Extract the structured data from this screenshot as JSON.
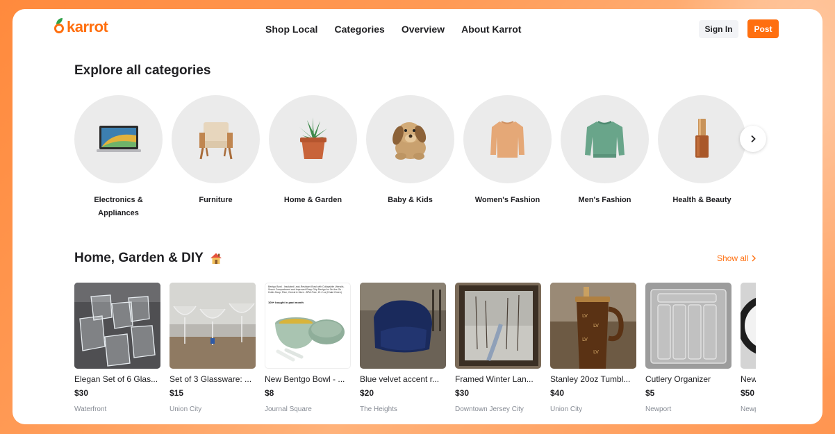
{
  "brand": {
    "name": "karrot",
    "color": "#ff6f0f",
    "leaf_color": "#2fa24a"
  },
  "nav": {
    "items": [
      "Shop Local",
      "Categories",
      "Overview",
      "About Karrot"
    ]
  },
  "header": {
    "signin_label": "Sign In",
    "post_label": "Post"
  },
  "categories": {
    "title": "Explore all categories",
    "items": [
      {
        "label": "Electronics & Appliances",
        "icon": "laptop-icon"
      },
      {
        "label": "Furniture",
        "icon": "armchair-icon"
      },
      {
        "label": "Home & Garden",
        "icon": "plant-icon"
      },
      {
        "label": "Baby & Kids",
        "icon": "plush-dog-icon"
      },
      {
        "label": "Women's Fashion",
        "icon": "sweater-icon"
      },
      {
        "label": "Men's Fashion",
        "icon": "sweatshirt-icon"
      },
      {
        "label": "Health & Beauty",
        "icon": "foundation-bottle-icon"
      }
    ],
    "next_icon": "chevron-right-icon"
  },
  "section": {
    "title": "Home, Garden & DIY",
    "title_icon": "house-icon",
    "show_all_label": "Show all",
    "items": [
      {
        "title": "Elegan Set of 6 Glas...",
        "price": "$30",
        "location": "Waterfront"
      },
      {
        "title": "Set of 3 Glassware: ...",
        "price": "$15",
        "location": "Union City"
      },
      {
        "title": "New Bentgo Bowl - ...",
        "price": "$8",
        "location": "Journal Square"
      },
      {
        "title": "Blue velvet accent r...",
        "price": "$20",
        "location": "The Heights"
      },
      {
        "title": "Framed Winter Lan...",
        "price": "$30",
        "location": "Downtown Jersey City"
      },
      {
        "title": "Stanley 20oz Tumbl...",
        "price": "$40",
        "location": "Union City"
      },
      {
        "title": "Cutlery Organizer",
        "price": "$5",
        "location": "Newport"
      },
      {
        "title": "New",
        "price": "$50",
        "location": "Newp"
      }
    ],
    "bentgo_thumb_text": [
      "Bentgo Bowl - Insulated Leak-Resistant Bowl with Collapsible Utensils, Snack Compartment and Improved Easy-Grip Design for On-the-Go - Holds Soup, Rice, Cereal & More - BPA-Free, 21.2 oz (Khaki Green)",
      "100+ bought in past month"
    ]
  }
}
